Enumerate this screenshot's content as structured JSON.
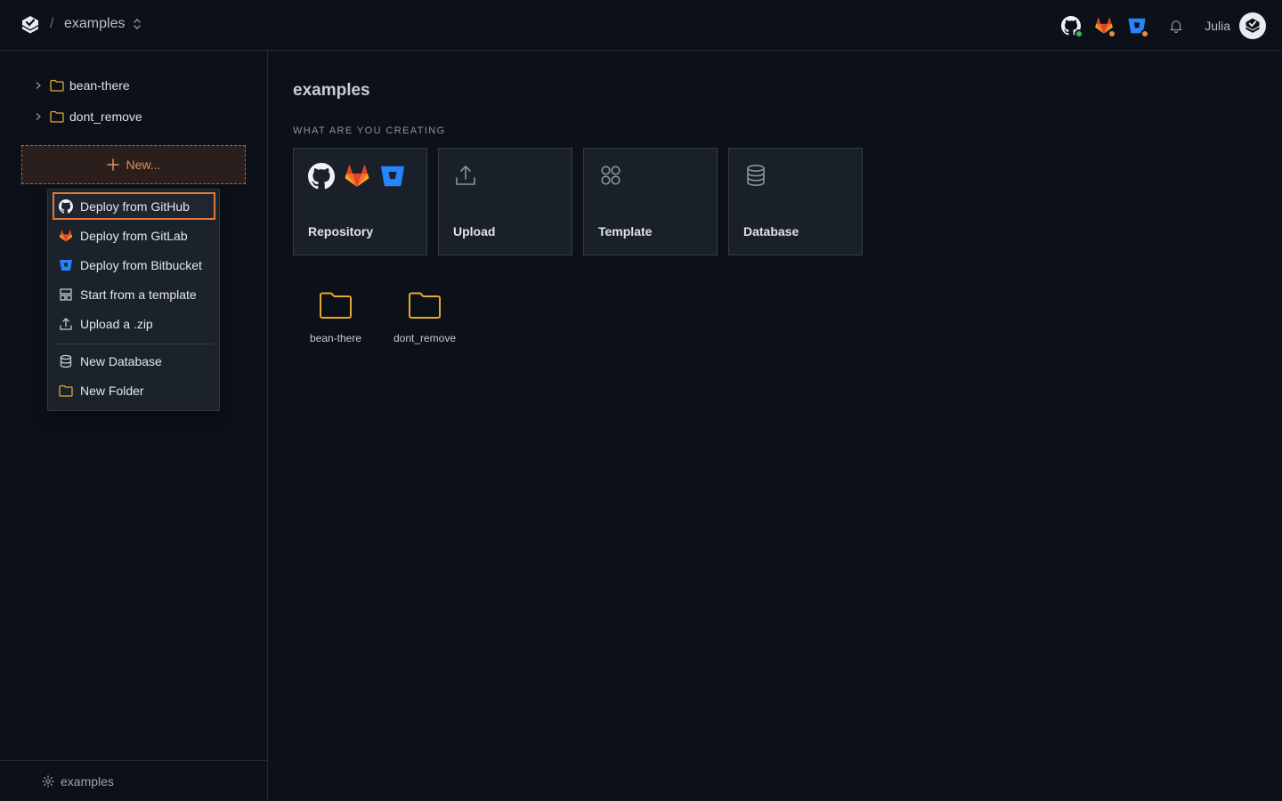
{
  "header": {
    "project_name": "examples",
    "user_name": "Julia",
    "integrations": [
      {
        "icon": "github-icon",
        "status_color": "#3fb950"
      },
      {
        "icon": "gitlab-icon",
        "status_color": "#f0883e"
      },
      {
        "icon": "bitbucket-icon",
        "status_color": "#f0883e"
      }
    ]
  },
  "sidebar": {
    "tree": [
      {
        "label": "bean-there",
        "icon": "folder-icon"
      },
      {
        "label": "dont_remove",
        "icon": "folder-icon"
      }
    ],
    "new_button_label": "New...",
    "menu": [
      {
        "label": "Deploy from GitHub",
        "icon": "github-icon"
      },
      {
        "label": "Deploy from GitLab",
        "icon": "gitlab-icon"
      },
      {
        "label": "Deploy from Bitbucket",
        "icon": "bitbucket-icon"
      },
      {
        "label": "Start from a template",
        "icon": "template-icon"
      },
      {
        "label": "Upload a .zip",
        "icon": "upload-icon"
      },
      {
        "label": "New Database",
        "icon": "database-icon"
      },
      {
        "label": "New Folder",
        "icon": "folder-icon"
      }
    ],
    "footer_label": "examples"
  },
  "main": {
    "title": "examples",
    "section_label": "WHAT ARE YOU CREATING",
    "cards": [
      {
        "label": "Repository",
        "icons": [
          "github-icon",
          "gitlab-icon",
          "bitbucket-icon"
        ]
      },
      {
        "label": "Upload",
        "icons": [
          "upload-icon"
        ]
      },
      {
        "label": "Template",
        "icons": [
          "template-icon"
        ]
      },
      {
        "label": "Database",
        "icons": [
          "database-icon"
        ]
      }
    ],
    "folders": [
      {
        "label": "bean-there"
      },
      {
        "label": "dont_remove"
      }
    ]
  },
  "colors": {
    "accent": "#e07a35",
    "folder": "#e5a82e",
    "background": "#0c1119"
  }
}
